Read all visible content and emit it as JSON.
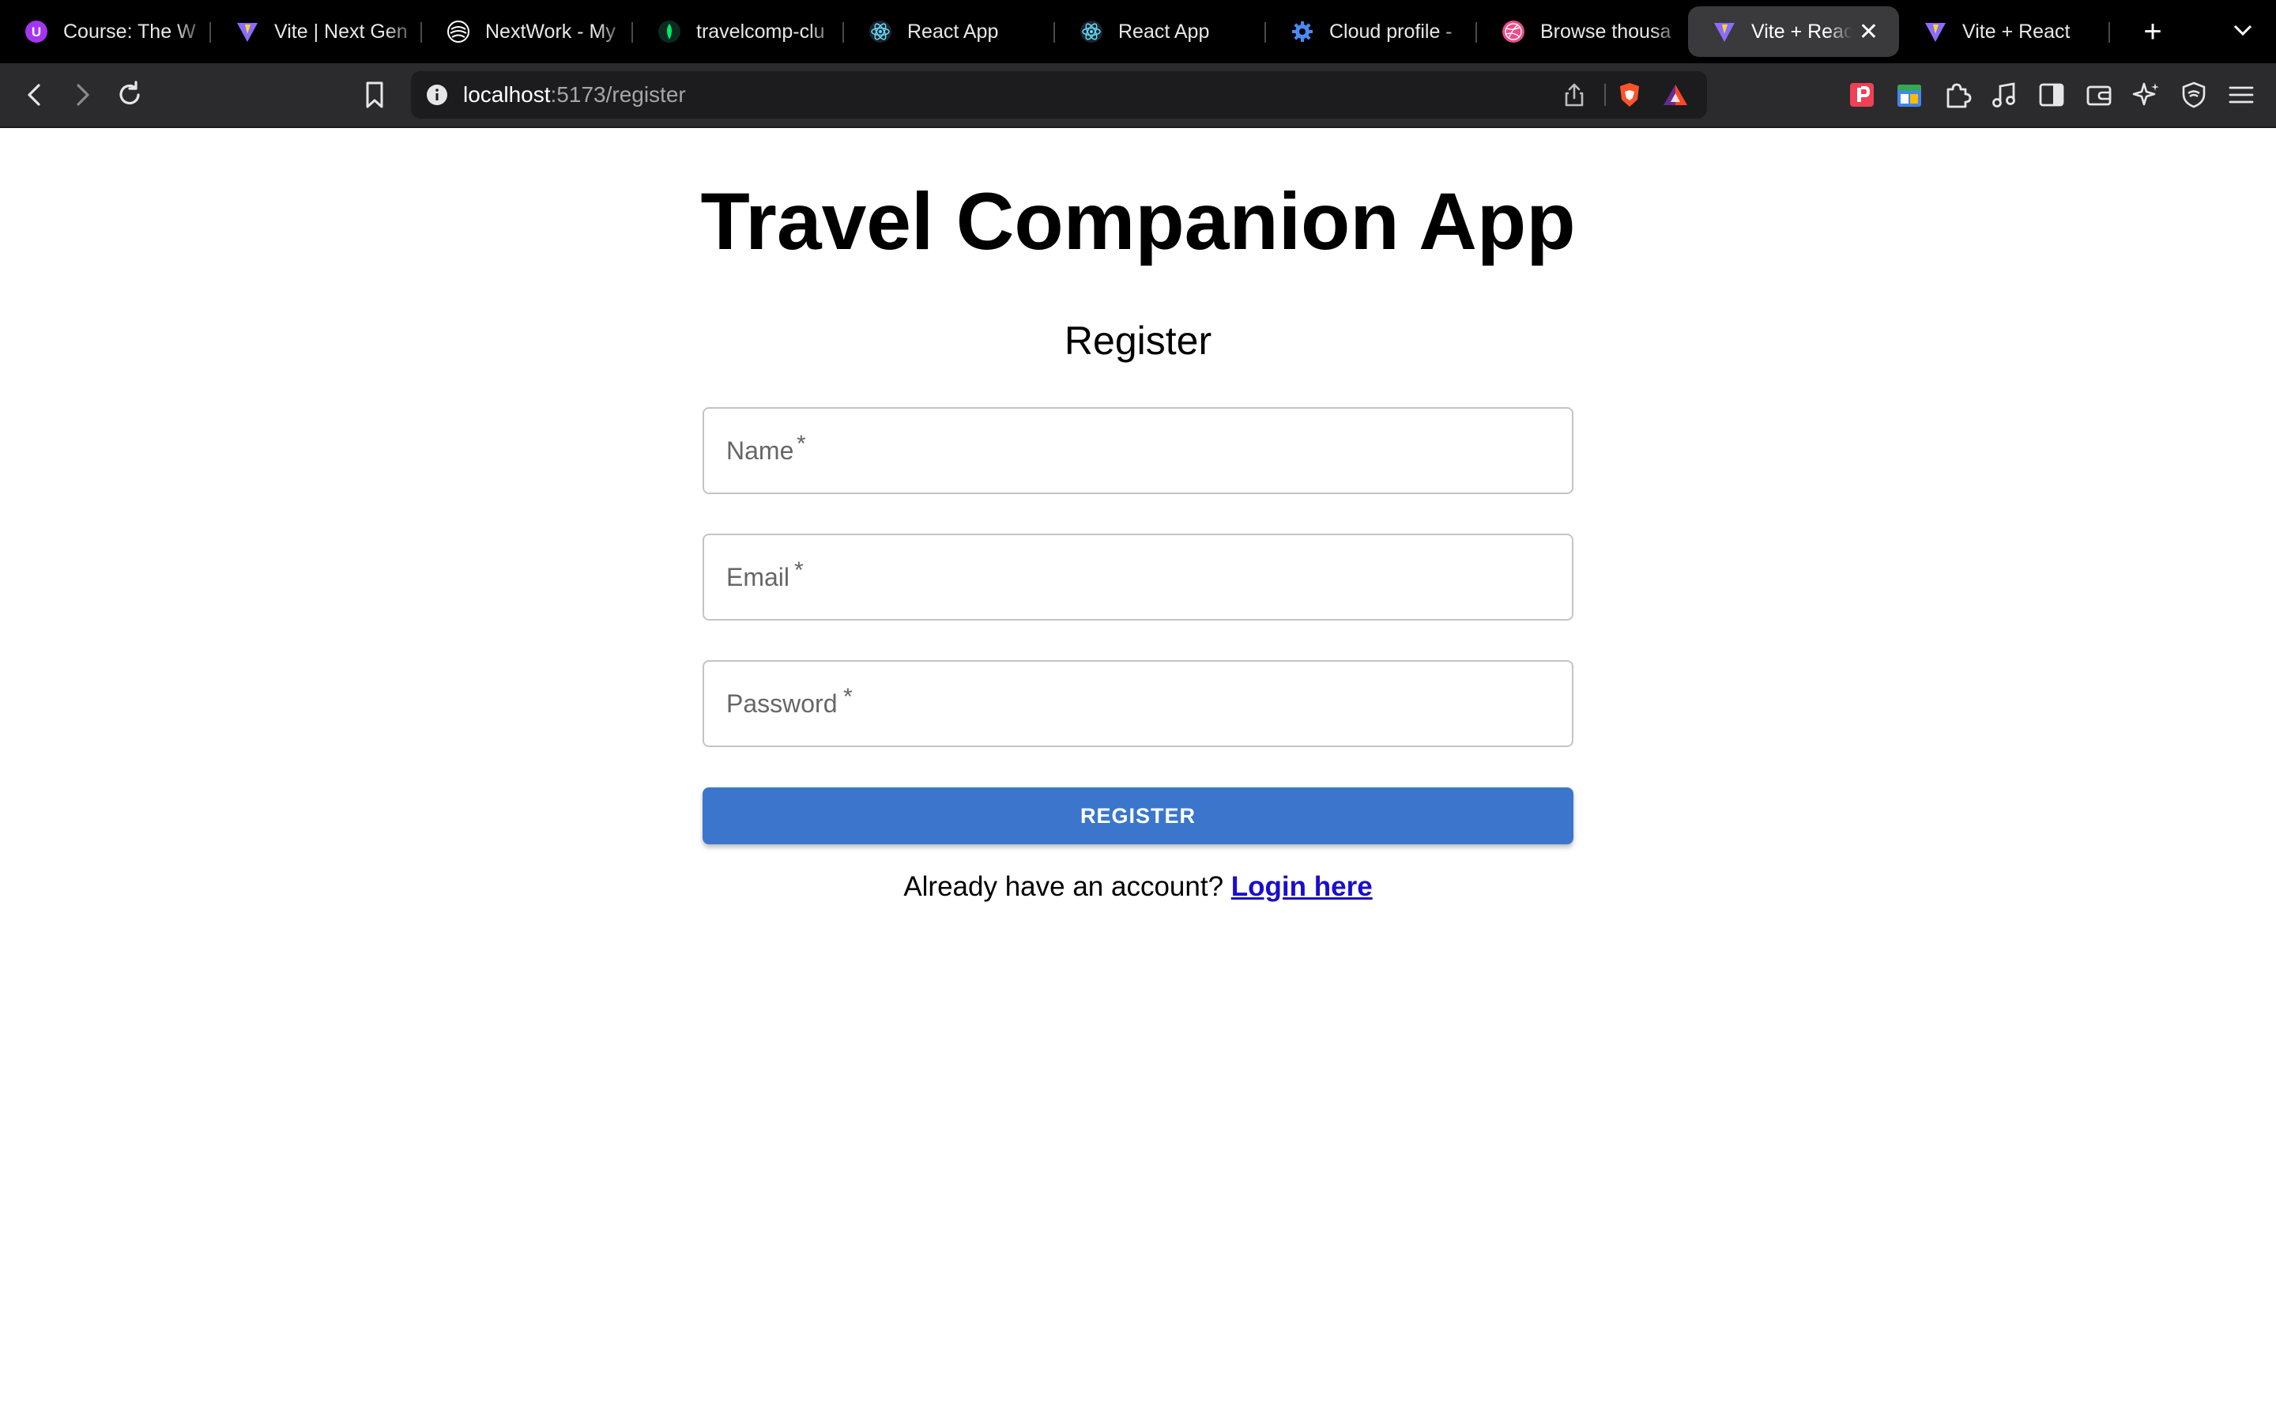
{
  "browser": {
    "tabs": [
      {
        "title": "Course: The W",
        "icon": "udemy-icon",
        "color": "#a435f0"
      },
      {
        "title": "Vite | Next Gen",
        "icon": "vite-icon",
        "color": "#646cff"
      },
      {
        "title": "NextWork - My",
        "icon": "nextwork-icon",
        "color": "#ffffff"
      },
      {
        "title": "travelcomp-clu",
        "icon": "mongodb-leaf-icon",
        "color": "#00ed64"
      },
      {
        "title": "React App",
        "icon": "react-icon",
        "color": "#61dafb"
      },
      {
        "title": "React App",
        "icon": "react-icon",
        "color": "#61dafb"
      },
      {
        "title": "Cloud profile -",
        "icon": "gear-icon",
        "color": "#4a8af4"
      },
      {
        "title": "Browse thousa",
        "icon": "dribbble-icon",
        "color": "#ea4c89"
      },
      {
        "title": "Vite + Reac",
        "icon": "vite-icon",
        "color": "#646cff",
        "active": true
      },
      {
        "title": "Vite + React",
        "icon": "vite-icon",
        "color": "#646cff"
      }
    ],
    "new_tab_label": "+",
    "close_label": "✕",
    "url": {
      "host": "localhost",
      "path": ":5173/register"
    }
  },
  "page": {
    "app_title": "Travel Companion App",
    "form_heading": "Register",
    "fields": {
      "name_placeholder": "Name",
      "email_placeholder": "Email",
      "password_placeholder": "Password",
      "required_mark": "*"
    },
    "register_label": "REGISTER",
    "login_prompt": "Already have an account?",
    "login_link": "Login here"
  },
  "colors": {
    "button_blue": "#3b76cc",
    "link_blue": "#1a0dcc"
  }
}
